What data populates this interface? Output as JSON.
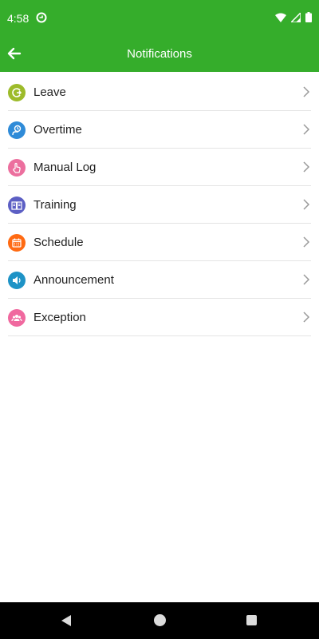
{
  "status_bar": {
    "time": "4:58",
    "icons": [
      "app-notification-icon",
      "wifi-icon",
      "signal-icon",
      "battery-icon"
    ]
  },
  "header": {
    "title": "Notifications",
    "back_icon": "arrow-left-icon",
    "color": "#35ad2b"
  },
  "items": [
    {
      "label": "Leave",
      "icon": "leave-icon",
      "color": "#9dbb2a"
    },
    {
      "label": "Overtime",
      "icon": "overtime-icon",
      "color": "#2f8bd8"
    },
    {
      "label": "Manual Log",
      "icon": "hand-touch-icon",
      "color": "#ec6f9e"
    },
    {
      "label": "Training",
      "icon": "book-icon",
      "color": "#5c5fc4"
    },
    {
      "label": "Schedule",
      "icon": "calendar-icon",
      "color": "#ff6a12"
    },
    {
      "label": "Announcement",
      "icon": "speaker-icon",
      "color": "#1e93c6"
    },
    {
      "label": "Exception",
      "icon": "people-icon",
      "color": "#f0699f"
    }
  ],
  "nav_bar": {
    "icons": [
      "nav-back-icon",
      "nav-home-icon",
      "nav-recents-icon"
    ]
  }
}
